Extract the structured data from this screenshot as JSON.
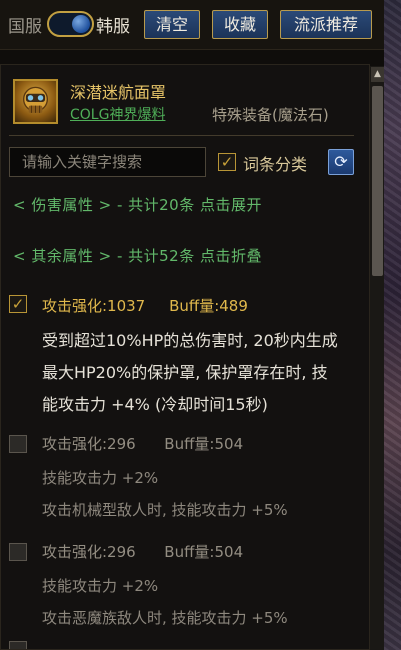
{
  "toolbar": {
    "server_cn": "国服",
    "server_kr": "韩服",
    "clear_label": "清空",
    "favorite_label": "收藏",
    "recommend_label": "流派推荐"
  },
  "item": {
    "name": "深潜迷航面罩",
    "source": "COLG神界爆料",
    "type": "特殊装备(魔法石)"
  },
  "filter": {
    "search_placeholder": "请输入关键字搜索",
    "search_value": "",
    "category_label": "词条分类",
    "category_checked": true
  },
  "sections": {
    "damage": "< 伤害属性 > - 共计20条 点击展开",
    "other": "< 其余属性 > - 共计52条 点击折叠"
  },
  "entries": [
    {
      "checked": true,
      "stats": "攻击强化:1037     Buff量:489",
      "lines": [
        "受到超过10%HP的总伤害时, 20秒内生成",
        "最大HP20%的保护罩, 保护罩存在时, 技",
        "能攻击力 +4% (冷却时间15秒)"
      ]
    },
    {
      "checked": false,
      "stats": "攻击强化:296      Buff量:504",
      "lines": [
        "技能攻击力 +2%",
        "攻击机械型敌人时, 技能攻击力 +5%"
      ]
    },
    {
      "checked": false,
      "stats": "攻击强化:296      Buff量:504",
      "lines": [
        "技能攻击力 +2%",
        "攻击恶魔族敌人时, 技能攻击力 +5%"
      ]
    }
  ],
  "icons": {
    "refresh": "refresh-icon",
    "check": "✓",
    "scroll_up": "▲"
  },
  "colors": {
    "accent_gold": "#e6c468",
    "accent_green": "#62b86a",
    "button_blue": "#2b4a78"
  }
}
